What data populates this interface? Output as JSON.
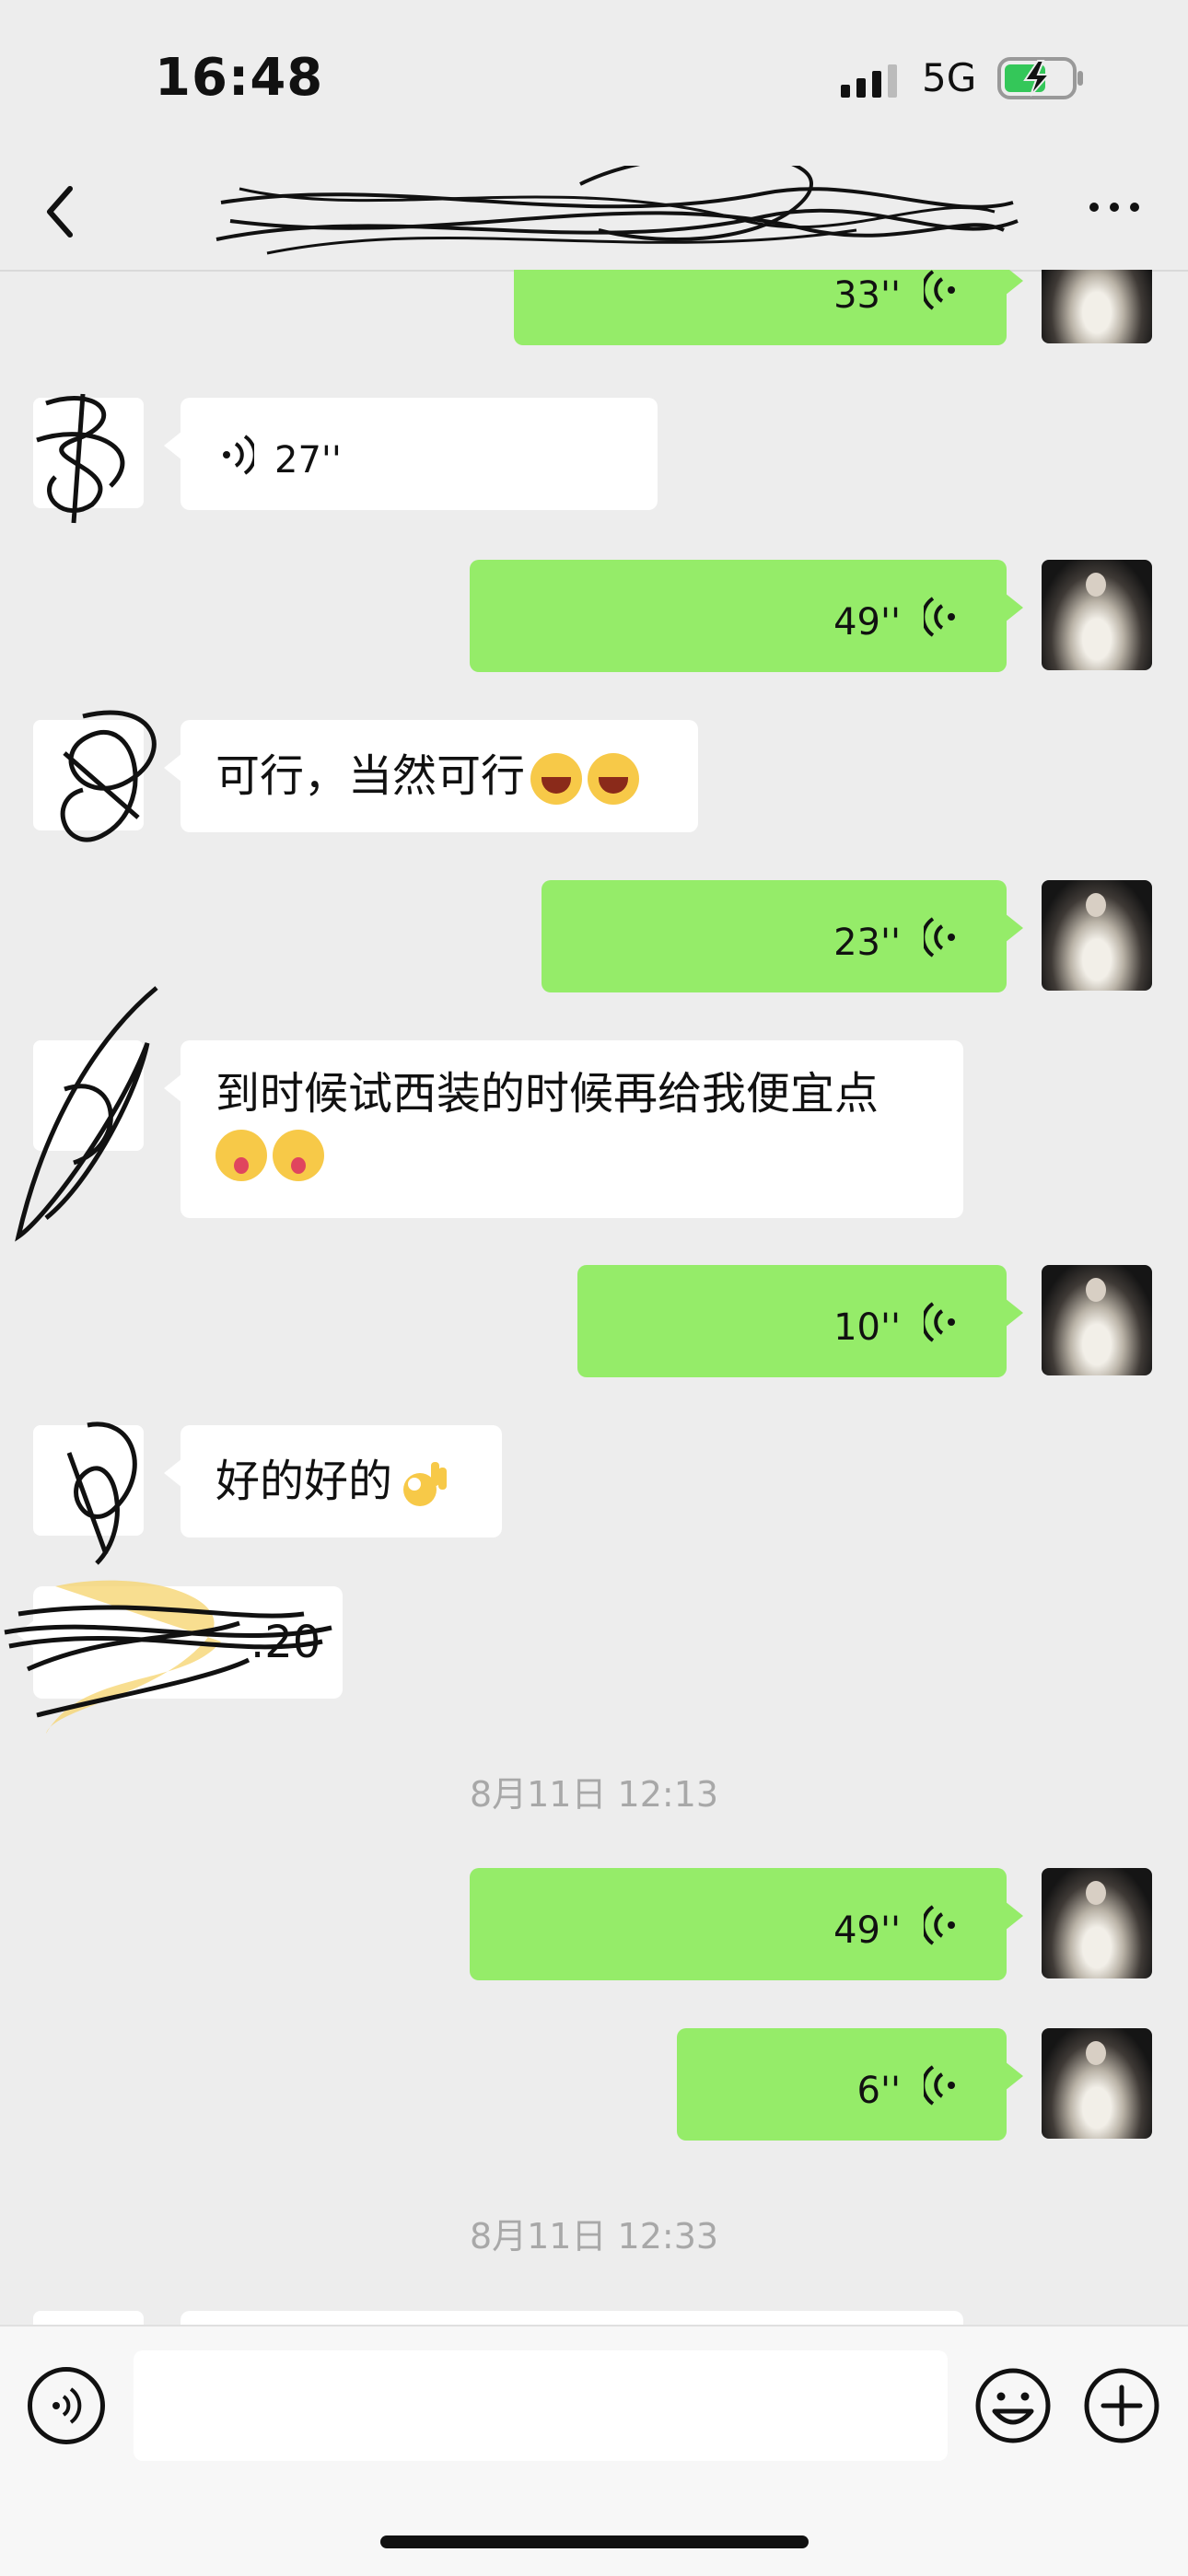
{
  "status": {
    "time": "16:48",
    "network": "5G"
  },
  "nav": {
    "title": ""
  },
  "messages": [
    {
      "side": "me",
      "type": "voice",
      "duration": "33''"
    },
    {
      "side": "other",
      "type": "voice",
      "duration": "27''"
    },
    {
      "side": "me",
      "type": "voice",
      "duration": "49''"
    },
    {
      "side": "other",
      "type": "text",
      "text": "可行，当然可行"
    },
    {
      "side": "me",
      "type": "voice",
      "duration": "23''"
    },
    {
      "side": "other",
      "type": "text",
      "text": "到时候试西装的时候再给我便宜点"
    },
    {
      "side": "me",
      "type": "voice",
      "duration": "10''"
    },
    {
      "side": "other",
      "type": "text",
      "text": "好的好的"
    },
    {
      "side": "other",
      "type": "partial",
      "text": ".20"
    },
    {
      "side": "me",
      "type": "voice",
      "duration": "49''"
    },
    {
      "side": "me",
      "type": "voice",
      "duration": "6''"
    }
  ],
  "timestamps": [
    "8月11日 12:13",
    "8月11日 12:33"
  ],
  "colors": {
    "my_bubble": "#95ec69",
    "other_bubble": "#ffffff",
    "background": "#ededed"
  },
  "icons": [
    "back-icon",
    "more-icon",
    "voice-wave-icon",
    "emoji-icon",
    "plus-icon"
  ]
}
